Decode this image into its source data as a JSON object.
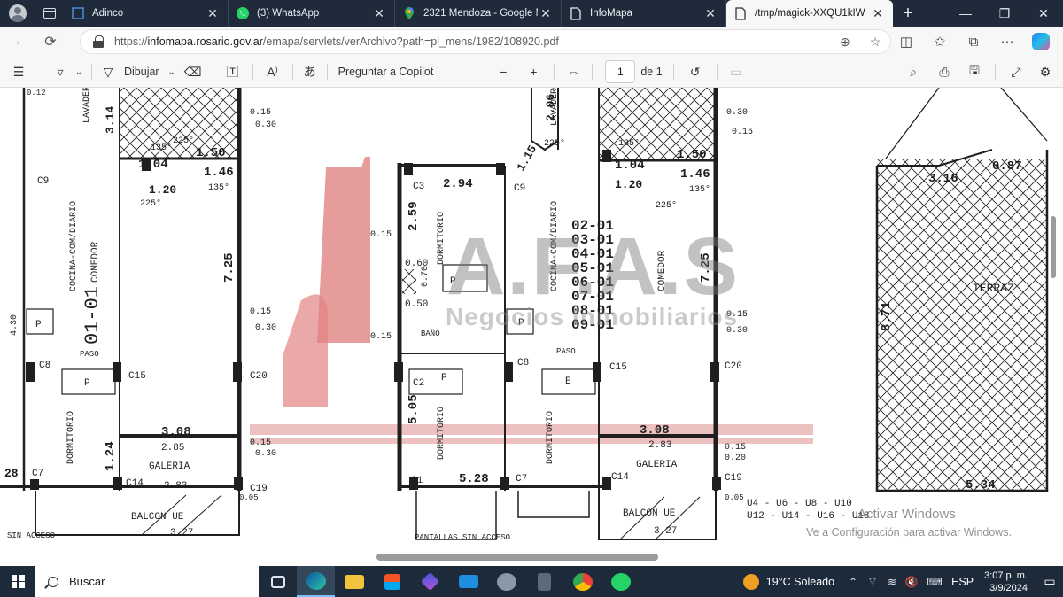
{
  "tabs": [
    {
      "label": "Adinco",
      "icon": "edge-blank-icon",
      "active": false
    },
    {
      "label": "(3) WhatsApp",
      "icon": "whatsapp-icon",
      "active": false
    },
    {
      "label": "2321 Mendoza - Google Ma",
      "icon": "google-maps-icon",
      "active": false
    },
    {
      "label": "InfoMapa",
      "icon": "document-icon",
      "active": false
    },
    {
      "label": "/tmp/magick-XXQU1kIW",
      "icon": "document-icon",
      "active": true
    }
  ],
  "address": {
    "prefix": "https://",
    "host": "infomapa.rosario.gov.ar",
    "path": "/emapa/servlets/verArchivo?path=pl_mens/1982/108920.pdf"
  },
  "pdf_toolbar": {
    "draw_label": "Dibujar",
    "copilot_label": "Preguntar a Copilot",
    "page_current": "1",
    "page_total": "de 1"
  },
  "document": {
    "watermark": "A.F.A.S",
    "watermark_sub": "Negocios Inmobiliarios",
    "activation_title": "Activar Windows",
    "activation_sub": "Ve a Configuración para activar Windows.",
    "plan_labels": {
      "unit_left": "01-01",
      "unit_list": [
        "02-01",
        "03-01",
        "04-01",
        "05-01",
        "06-01",
        "07-01",
        "08-01",
        "09-01"
      ],
      "cocina": "COCINA-COM/DIARIO",
      "comedor": "COMEDOR",
      "dormitorio": "DORMITORIO",
      "galeria": "GALERIA",
      "balcon": "BALCON UE",
      "paso": "PASO",
      "bano": "BAÑO",
      "terraza": "TERRAZ",
      "lavadero": "LAVADERO",
      "sin_acceso": "SIN ACCESO",
      "pantallas": "PANTALLAS SIN ACCESO",
      "units_note1": "U4 - U6 - U8 - U10",
      "units_note2": "U12 - U14 - U16 - U18",
      "dims": {
        "d308a": "3.08",
        "d308b": "3.08",
        "d285a": "2.85",
        "d283a": "2.83",
        "d283b": "2.83",
        "d327a": "3.27",
        "d327b": "3.27",
        "d725a": "7.25",
        "d725b": "7.25",
        "d314": "3.14",
        "d294": "2.94",
        "d259": "2.59",
        "d505": "5.05",
        "d528": "5.28",
        "d534": "5.34",
        "d316": "3.16",
        "d871": "8.71",
        "d146a": "1.46",
        "d146b": "1.46",
        "d150a": "1.50",
        "d150b": "1.50",
        "d104a": "1.04",
        "d104b": "1.04",
        "d120a": "1.20",
        "d120b": "1.20",
        "d206": "2.06",
        "d124": "1.24",
        "d115": "1.15",
        "d060": "0.60",
        "d050": "0.50",
        "d070": "0.70",
        "d015": "0.15",
        "d030": "0.30",
        "d020": "0.20",
        "d005": "0.05",
        "d012": "0.12",
        "d430": "4.30",
        "d225": "225°",
        "d135": "135°",
        "d087": "0.87",
        "c9": "C9",
        "c8": "C8",
        "c7": "C7",
        "c14": "C14",
        "c15": "C15",
        "c19": "C19",
        "c20": "C20",
        "c3": "C3",
        "c2": "C2",
        "c1": "C1",
        "p": "P",
        "e": "E",
        "d028": "28"
      }
    }
  },
  "taskbar": {
    "search_label": "Buscar",
    "weather": "19°C  Soleado",
    "lang": "ESP",
    "time": "3:07 p. m.",
    "date": "3/9/2024"
  },
  "colors": {
    "tabstrip": "#1f2b3a",
    "taskbar": "#1c2a3a",
    "watermark_red": "#d94040"
  }
}
